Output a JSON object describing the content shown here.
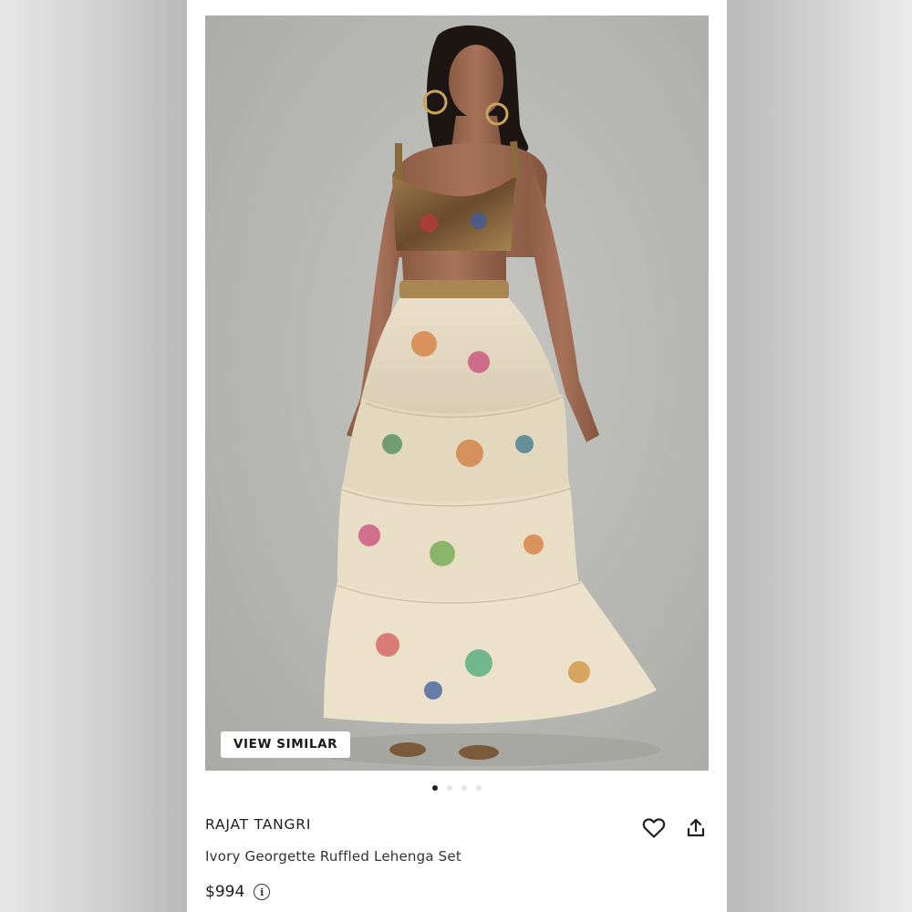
{
  "product": {
    "brand": "RAJAT TANGRI",
    "name": "Ivory Georgette Ruffled Lehenga Set",
    "price": "$994"
  },
  "gallery": {
    "view_similar_label": "VIEW SIMILAR",
    "image_count": 4,
    "active_index": 0
  },
  "icons": {
    "wishlist": "heart-icon",
    "share": "share-upload-icon",
    "price_info": "info-circle-icon"
  },
  "colors": {
    "accent": "#1f1f1f",
    "background": "#ffffff"
  }
}
